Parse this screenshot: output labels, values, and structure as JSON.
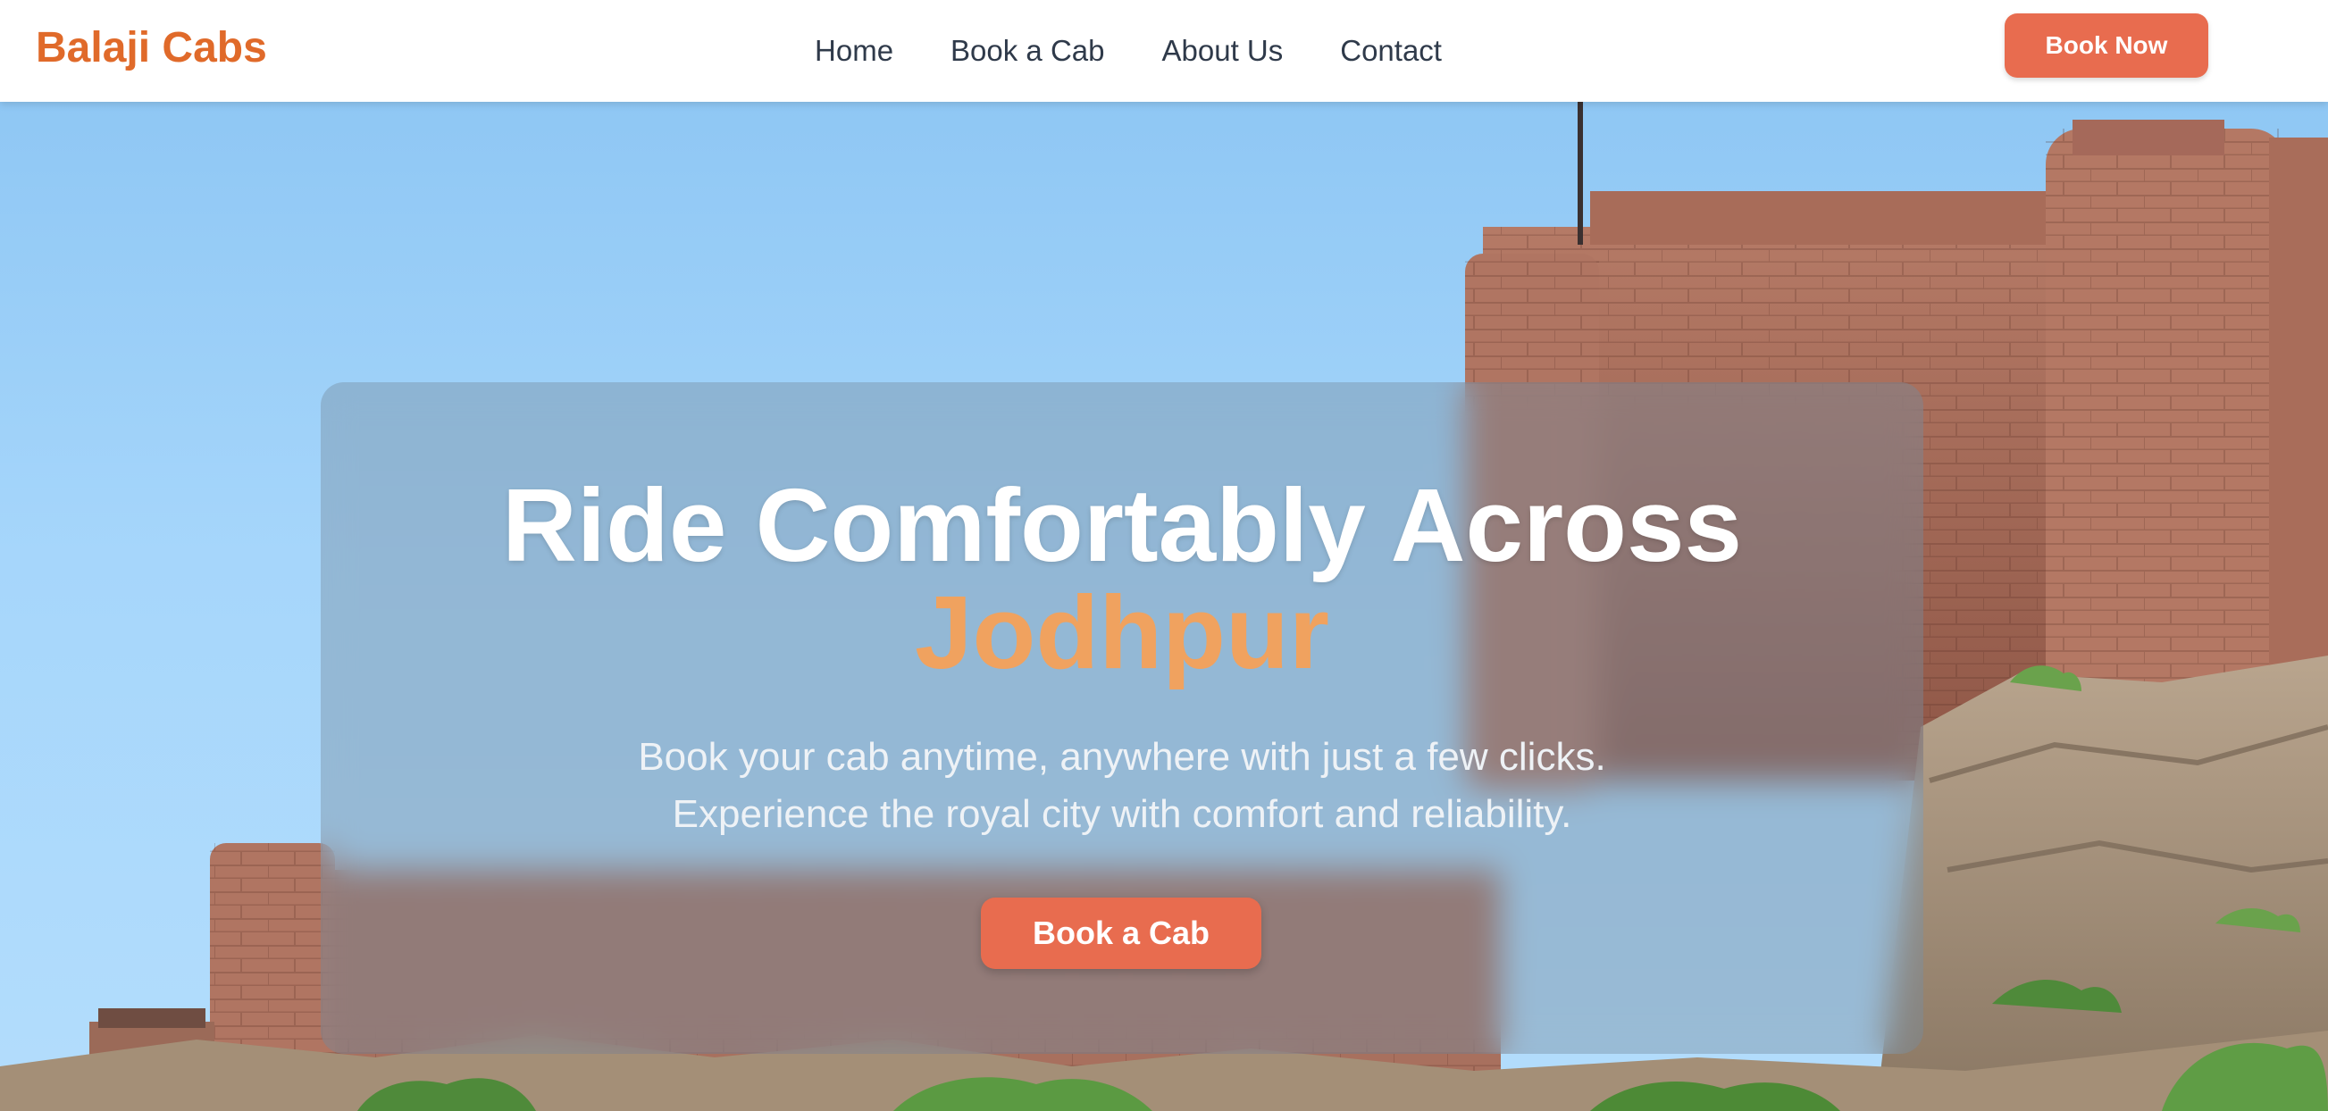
{
  "header": {
    "logo": "Balaji Cabs",
    "nav": [
      "Home",
      "Book a Cab",
      "About Us",
      "Contact"
    ],
    "book_now_label": "Book Now"
  },
  "hero": {
    "headline": "Ride Comfortably Across",
    "headline_city": "Jodhpur",
    "subtitle_line1": "Book your cab anytime, anywhere with just a few clicks.",
    "subtitle_line2": "Experience the royal city with comfort and reliability.",
    "cta_label": "Book a Cab",
    "background": "fort-image"
  },
  "colors": {
    "brand": "#e06a2a",
    "button": "#e86c4f",
    "accent": "#f0a25f"
  }
}
